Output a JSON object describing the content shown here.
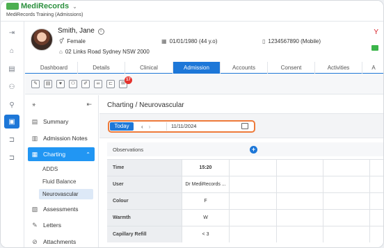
{
  "app": {
    "brand": "MediRecords",
    "org_name": "MediRecords Training (Admissions)"
  },
  "patient": {
    "name": "Smith, Jane",
    "gender": "Female",
    "dob": "01/01/1980 (44 y.o)",
    "phone": "1234567890 (Mobile)",
    "address": "02 Links Road Sydney NSW 2000"
  },
  "tabs": [
    {
      "label": "Dashboard",
      "active": false
    },
    {
      "label": "Details",
      "active": false
    },
    {
      "label": "Clinical",
      "active": false
    },
    {
      "label": "Admission",
      "active": true
    },
    {
      "label": "Accounts",
      "active": false
    },
    {
      "label": "Consent",
      "active": false
    },
    {
      "label": "Activities",
      "active": false
    },
    {
      "label": "A",
      "active": false
    }
  ],
  "toolbar": {
    "notification_count": "17"
  },
  "nav": {
    "items": [
      {
        "label": "Summary",
        "icon": "summary-icon"
      },
      {
        "label": "Admission Notes",
        "icon": "notes-icon"
      },
      {
        "label": "Charting",
        "icon": "charting-icon",
        "active": true
      },
      {
        "label": "Assessments",
        "icon": "assessments-icon"
      },
      {
        "label": "Letters",
        "icon": "letters-icon"
      },
      {
        "label": "Attachments",
        "icon": "attachments-icon"
      }
    ],
    "charting_sub": [
      {
        "label": "ADDS"
      },
      {
        "label": "Fluid Balance"
      },
      {
        "label": "Neurovascular",
        "active": true
      }
    ]
  },
  "main": {
    "breadcrumb": "Charting / Neurovascular",
    "today_label": "Today",
    "date_value": "11/11/2024",
    "observations_label": "Observations",
    "rows": [
      {
        "label": "Time",
        "value": "15:20"
      },
      {
        "label": "User",
        "value": "Dr MediRecords ..."
      },
      {
        "label": "Colour",
        "value": "F"
      },
      {
        "label": "Warmth",
        "value": "W"
      },
      {
        "label": "Capillary Refill",
        "value": "< 3"
      }
    ]
  },
  "colors": {
    "accent": "#1d77d8",
    "nav_active": "#2196f3",
    "highlight_outline": "#ee7a3a",
    "alert": "#e5322d"
  }
}
